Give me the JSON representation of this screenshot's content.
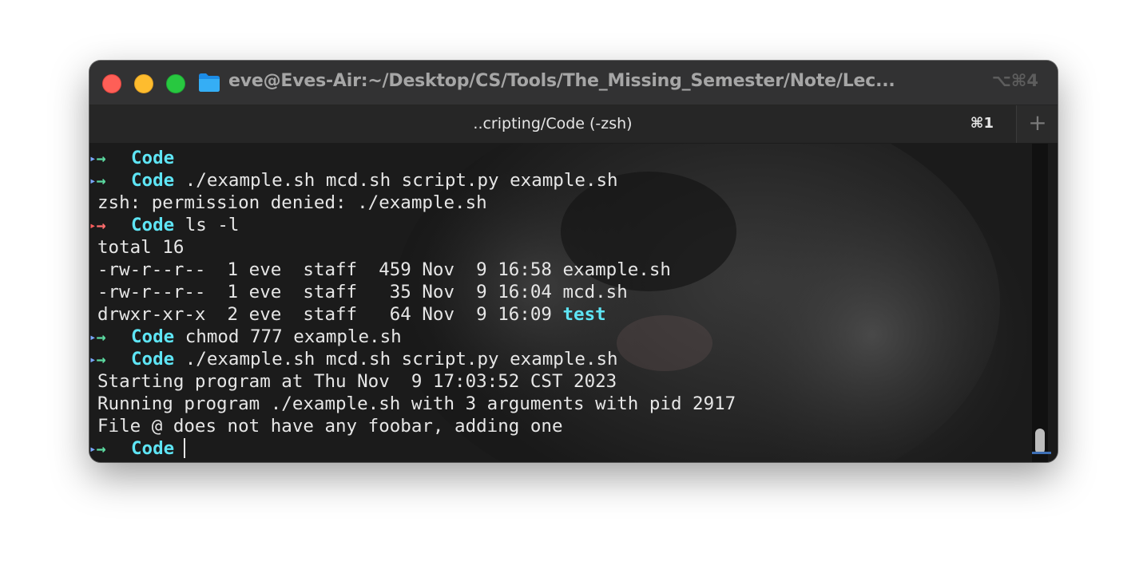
{
  "window": {
    "title": "eve@Eves-Air:~/Desktop/CS/Tools/The_Missing_Semester/Note/Lec...",
    "shortcut": "⌥⌘4",
    "folder_icon": "folder-icon"
  },
  "tabs": [
    {
      "label": "..cripting/Code (-zsh)",
      "shortcut": "⌘1",
      "active": true
    }
  ],
  "new_tab_label": "+",
  "prompt_dir": "Code",
  "terminal": {
    "lines": [
      {
        "type": "prompt",
        "status": "ok",
        "dir": "Code",
        "cmd": ""
      },
      {
        "type": "prompt",
        "status": "ok",
        "dir": "Code",
        "cmd": "./example.sh mcd.sh script.py example.sh"
      },
      {
        "type": "output",
        "text": "zsh: permission denied: ./example.sh"
      },
      {
        "type": "prompt",
        "status": "err",
        "dir": "Code",
        "cmd": "ls -l"
      },
      {
        "type": "output",
        "text": "total 16"
      },
      {
        "type": "output",
        "text": "-rw-r--r--  1 eve  staff  459 Nov  9 16:58 example.sh"
      },
      {
        "type": "output",
        "text": "-rw-r--r--  1 eve  staff   35 Nov  9 16:04 mcd.sh"
      },
      {
        "type": "output",
        "text": "drwxr-xr-x  2 eve  staff   64 Nov  9 16:09 ",
        "dir_entry": "test"
      },
      {
        "type": "prompt",
        "status": "ok",
        "dir": "Code",
        "cmd": "chmod 777 example.sh"
      },
      {
        "type": "prompt",
        "status": "ok",
        "dir": "Code",
        "cmd": "./example.sh mcd.sh script.py example.sh"
      },
      {
        "type": "output",
        "text": "Starting program at Thu Nov  9 17:03:52 CST 2023"
      },
      {
        "type": "output",
        "text": "Running program ./example.sh with 3 arguments with pid 2917"
      },
      {
        "type": "output",
        "text": "File @ does not have any foobar, adding one"
      },
      {
        "type": "prompt",
        "status": "ok",
        "dir": "Code",
        "cmd": "",
        "cursor": true
      }
    ],
    "prompt_arrow": "→",
    "prompt_marker": "▸"
  },
  "colors": {
    "accent_cyan": "#5ee5f5",
    "arrow_ok": "#5bd9a0",
    "arrow_err": "#ff6e6e",
    "traffic_red": "#fe5f57",
    "traffic_yellow": "#febc2e",
    "traffic_green": "#28c840"
  }
}
